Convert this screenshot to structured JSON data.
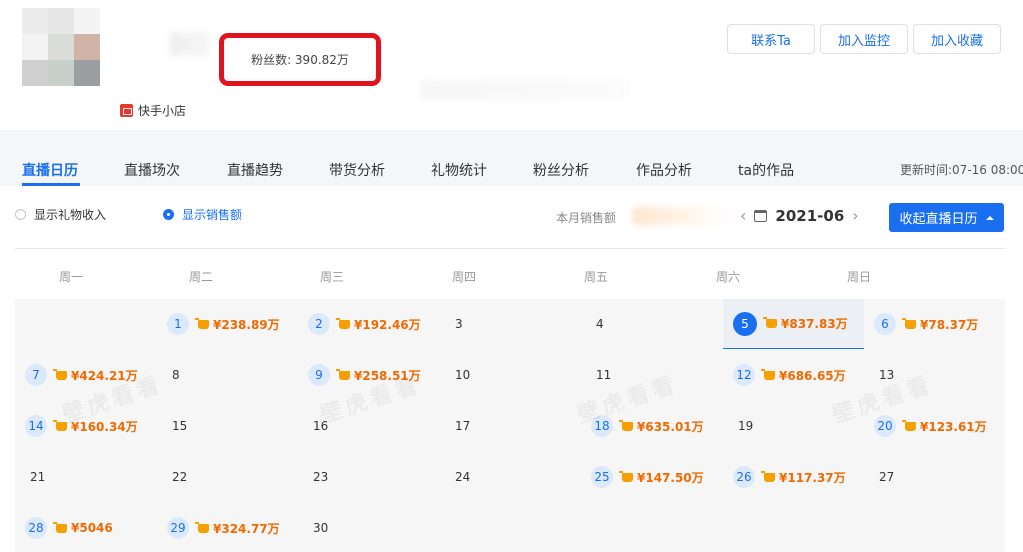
{
  "profile": {
    "fans_label": "粉丝数: 390.82万",
    "shop_label": "快手小店"
  },
  "header_buttons": [
    {
      "label": "联系Ta"
    },
    {
      "label": "加入监控"
    },
    {
      "label": "加入收藏"
    }
  ],
  "tabs": [
    {
      "label": "直播日历",
      "active": true
    },
    {
      "label": "直播场次"
    },
    {
      "label": "直播趋势"
    },
    {
      "label": "带货分析"
    },
    {
      "label": "礼物统计"
    },
    {
      "label": "粉丝分析"
    },
    {
      "label": "作品分析"
    },
    {
      "label": "ta的作品"
    }
  ],
  "updated_text": "更新时间:07-16 08:00",
  "options": {
    "gift_income": "显示礼物收入",
    "show_sales": "显示销售额"
  },
  "month_sales_label": "本月销售额",
  "month": "2021-06",
  "collapse_button": "收起直播日历",
  "weekdays": [
    "周一",
    "周二",
    "周三",
    "周四",
    "周五",
    "周六",
    "周日"
  ],
  "watermark": "壁虎看看",
  "calendar": [
    [
      {
        "day": ""
      },
      {
        "day": "1",
        "sales": "¥238.89万"
      },
      {
        "day": "2",
        "sales": "¥192.46万"
      },
      {
        "day": "3"
      },
      {
        "day": "4"
      },
      {
        "day": "5",
        "sales": "¥837.83万",
        "selected": true
      },
      {
        "day": "6",
        "sales": "¥78.37万"
      }
    ],
    [
      {
        "day": "7",
        "sales": "¥424.21万"
      },
      {
        "day": "8"
      },
      {
        "day": "9",
        "sales": "¥258.51万"
      },
      {
        "day": "10"
      },
      {
        "day": "11"
      },
      {
        "day": "12",
        "sales": "¥686.65万"
      },
      {
        "day": "13"
      }
    ],
    [
      {
        "day": "14",
        "sales": "¥160.34万"
      },
      {
        "day": "15"
      },
      {
        "day": "16"
      },
      {
        "day": "17"
      },
      {
        "day": "18",
        "sales": "¥635.01万"
      },
      {
        "day": "19"
      },
      {
        "day": "20",
        "sales": "¥123.61万"
      }
    ],
    [
      {
        "day": "21"
      },
      {
        "day": "22"
      },
      {
        "day": "23"
      },
      {
        "day": "24"
      },
      {
        "day": "25",
        "sales": "¥147.50万"
      },
      {
        "day": "26",
        "sales": "¥117.37万"
      },
      {
        "day": "27"
      }
    ],
    [
      {
        "day": "28",
        "sales": "¥5046"
      },
      {
        "day": "29",
        "sales": "¥324.77万"
      },
      {
        "day": "30"
      },
      {
        "day": ""
      },
      {
        "day": ""
      },
      {
        "day": ""
      },
      {
        "day": ""
      }
    ]
  ]
}
